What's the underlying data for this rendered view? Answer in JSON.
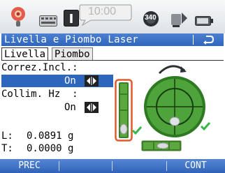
{
  "status": {
    "time": "10:00",
    "pill_label": "340",
    "battery_icon": "battery-icon",
    "wifi_icon": "signal-icon",
    "prism_icon": "prism-icon"
  },
  "titlebar": {
    "title": "Livella e Piombo Laser",
    "back_icon": "return-icon"
  },
  "tabs": [
    {
      "label": "Livella",
      "active": true
    },
    {
      "label": "Piombo",
      "active": false
    }
  ],
  "fields": {
    "correz_label": "Correz.Incl.:",
    "correz_value": "On",
    "collim_label": "Collim. Hz  :",
    "collim_value": "On",
    "l_label": "L:",
    "l_value": "0.0891 g",
    "t_label": "T:",
    "t_value": "0.0000 g"
  },
  "softkeys": {
    "left": "PREC",
    "right": "CONT"
  },
  "colors": {
    "accent": "#2f66bd",
    "level_green": "#2ea043",
    "highlight_red": "#e05a2a",
    "check_green": "#36b64a"
  }
}
